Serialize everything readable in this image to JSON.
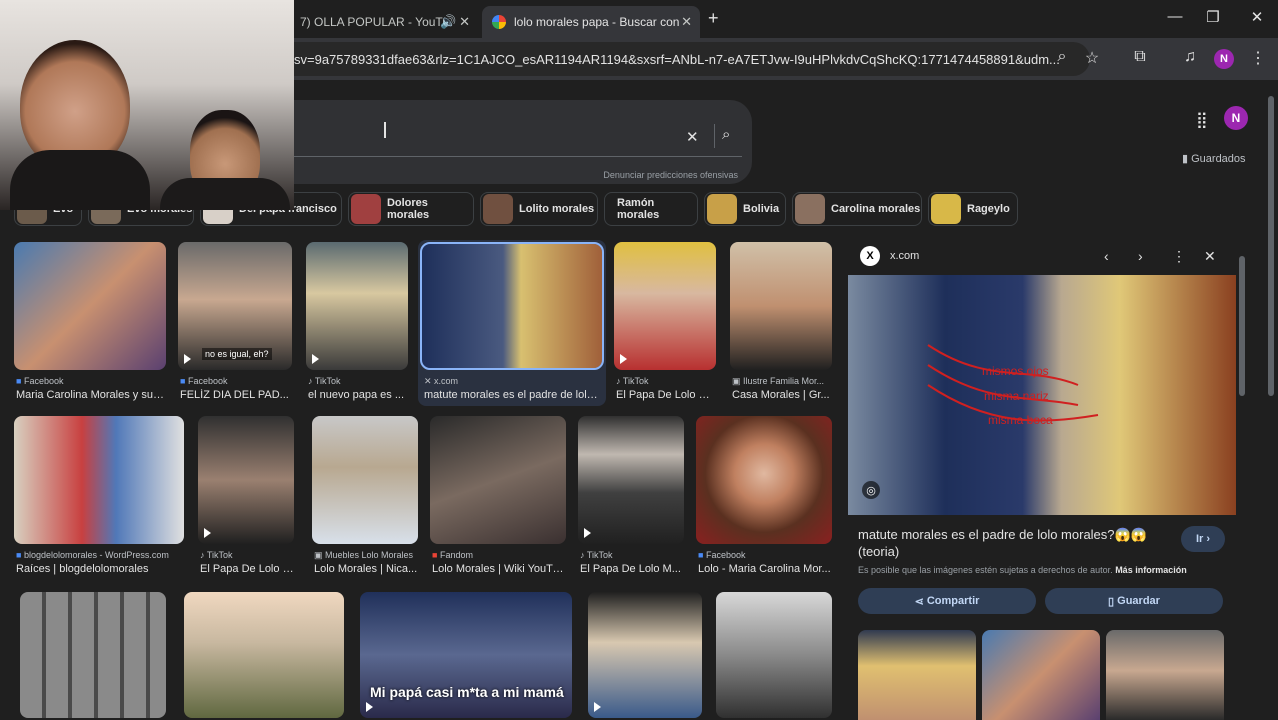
{
  "browser": {
    "tabs": [
      {
        "title": "7) OLLA POPULAR - YouTu",
        "active": false
      },
      {
        "title": "lolo morales papa - Buscar con",
        "active": true
      }
    ],
    "new_tab": "+",
    "url": "sv=9a75789331dfae63&rlz=1C1AJCO_esAR1194AR1194&sxsrf=ANbL-n7-eA7ETJvw-I9uHPlvkdvCqShcKQ:1771474458891&udm...",
    "profile_initial": "N"
  },
  "search": {
    "report_text": "Denunciar predicciones ofensivas",
    "saved_label": "Guardados",
    "profile_initial": "N"
  },
  "chips": [
    {
      "label": "Evo"
    },
    {
      "label": "Evo morales"
    },
    {
      "label": "Del papa francisco"
    },
    {
      "label": "Dolores morales"
    },
    {
      "label": "Lolito morales"
    },
    {
      "label": "Ramón morales"
    },
    {
      "label": "Bolivia"
    },
    {
      "label": "Carolina morales"
    },
    {
      "label": "Rageylo"
    }
  ],
  "results": [
    {
      "source": "Facebook",
      "title": "Maria Carolina Morales y su p..."
    },
    {
      "source": "Facebook",
      "title": "FELÍZ DIA DEL PAD..."
    },
    {
      "source": "TikTok",
      "title": "el nuevo papa es ..."
    },
    {
      "source": "x.com",
      "title": "matute morales es el padre de lolo ..."
    },
    {
      "source": "TikTok",
      "title": "El Papa De Lolo M..."
    },
    {
      "source": "Ilustre Familia Mor...",
      "title": "Casa Morales | Gr..."
    },
    {
      "source": "blogdelolomorales - WordPress.com",
      "title": "Raíces | blogdelolomorales"
    },
    {
      "source": "TikTok",
      "title": "El Papa De Lolo M..."
    },
    {
      "source": "Muebles Lolo Morales",
      "title": "Lolo Morales | Nica..."
    },
    {
      "source": "Fandom",
      "title": "Lolo Morales | Wiki YouTu..."
    },
    {
      "source": "TikTok",
      "title": "El Papa De Lolo M..."
    },
    {
      "source": "Facebook",
      "title": "Lolo - Maria Carolina Mor..."
    }
  ],
  "overlays": {
    "no_es_igual": "no es igual, eh?",
    "caption_bottom": "Mi papá casi m*ta a mi mamá"
  },
  "panel": {
    "site": "x.com",
    "title": "matute morales es el padre de lolo morales?😱😱 (teoria)",
    "visit_label": "Ir",
    "notice": "Es posible que las imágenes estén sujetas a derechos de autor.",
    "more_info": "Más información",
    "share_label": "Compartir",
    "save_label": "Guardar",
    "annotations": [
      "mismos ojos",
      "misma nariz",
      "misma boca"
    ]
  }
}
